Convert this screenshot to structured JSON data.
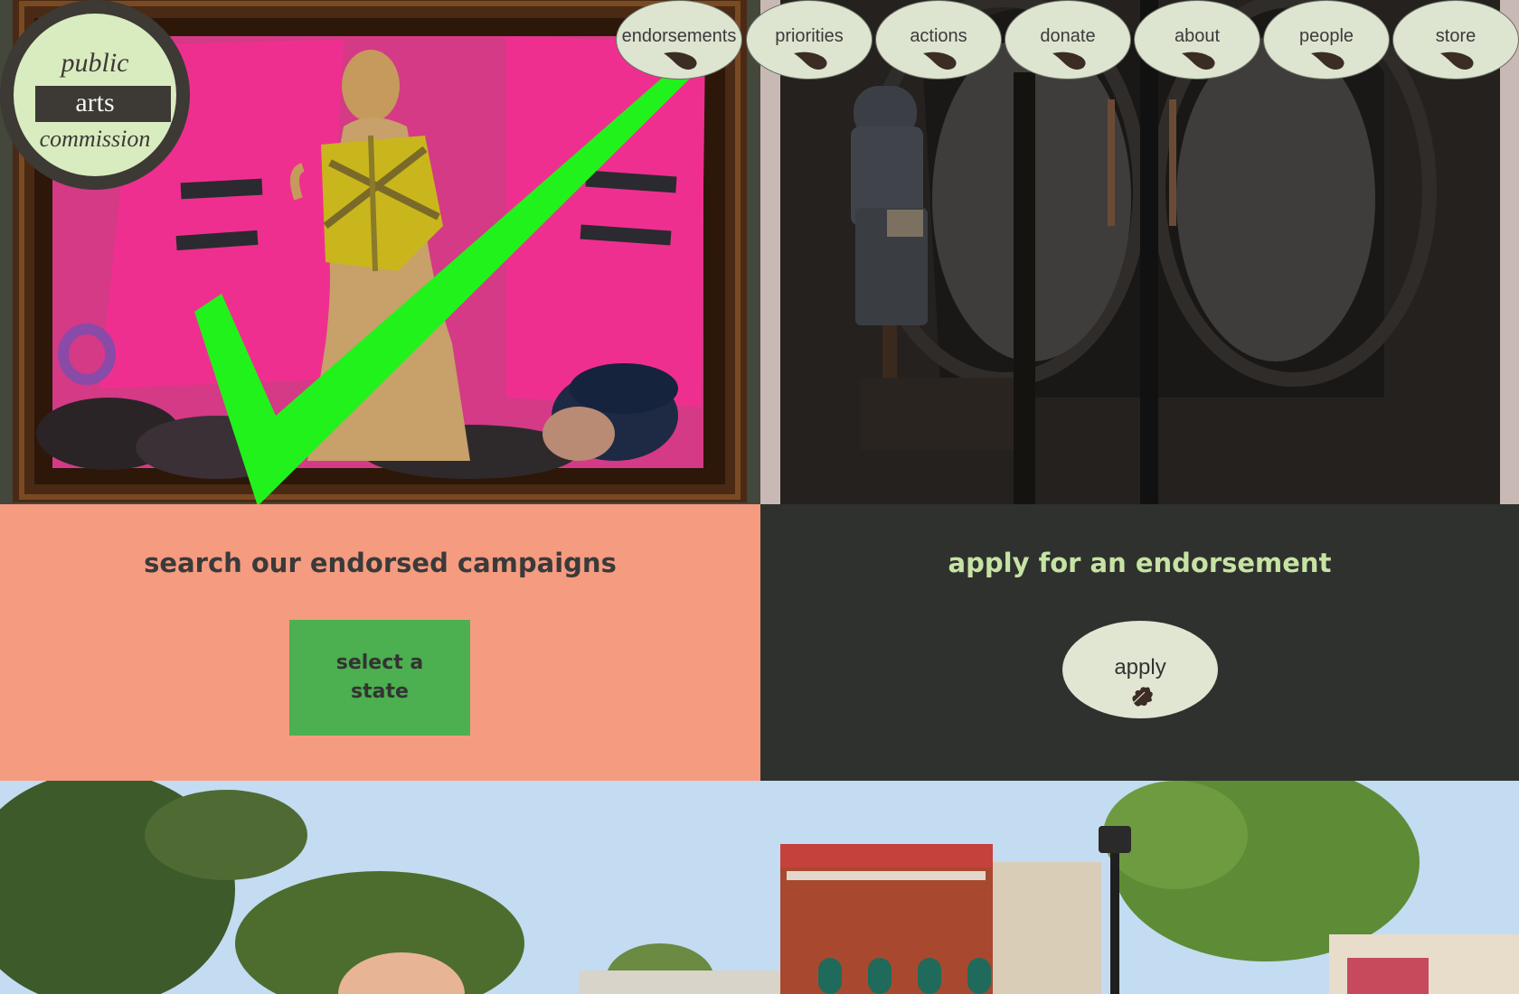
{
  "logo": {
    "line1": "public",
    "line2": "arts",
    "line3": "commission"
  },
  "nav": {
    "items": [
      {
        "label": "endorsements"
      },
      {
        "label": "priorities"
      },
      {
        "label": "actions"
      },
      {
        "label": "donate"
      },
      {
        "label": "about"
      },
      {
        "label": "people"
      },
      {
        "label": "store"
      }
    ]
  },
  "endorsed": {
    "title": "search our endorsed campaigns",
    "button_label": "select a state"
  },
  "apply": {
    "title": "apply for an endorsement",
    "button_label": "apply"
  },
  "colors": {
    "salmon": "#f59b80",
    "charcoal": "#2f312e",
    "mint": "#c6e3a4",
    "button_green": "#4caf50",
    "nav_oval": "#dde4d0",
    "checkmark": "#22f21c"
  },
  "icons": {
    "nav_item": "leaf-icon",
    "apply": "oak-leaf-icon"
  }
}
